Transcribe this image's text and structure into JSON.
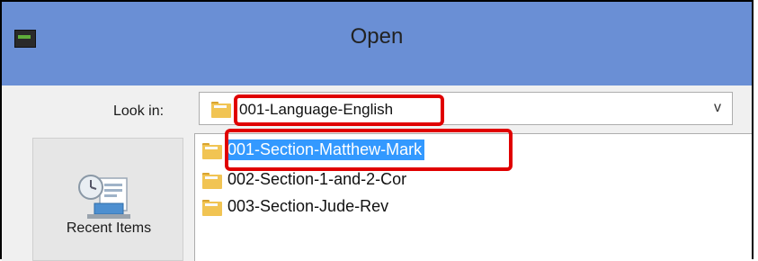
{
  "window": {
    "title": "Open"
  },
  "look_in": {
    "label": "Look in:",
    "value": "001-Language-English",
    "arrow": "v"
  },
  "places": [
    {
      "label": "Recent Items",
      "icon": "recent-items-icon"
    }
  ],
  "files": [
    {
      "name": "001-Section-Matthew-Mark",
      "icon": "folder-icon",
      "selected": true
    },
    {
      "name": "002-Section-1-and-2-Cor",
      "icon": "folder-icon",
      "selected": false
    },
    {
      "name": "003-Section-Jude-Rev",
      "icon": "folder-icon",
      "selected": false
    }
  ],
  "colors": {
    "titlebar": "#6a8fd5",
    "selection": "#3399ff",
    "highlight_box": "#e00000"
  }
}
